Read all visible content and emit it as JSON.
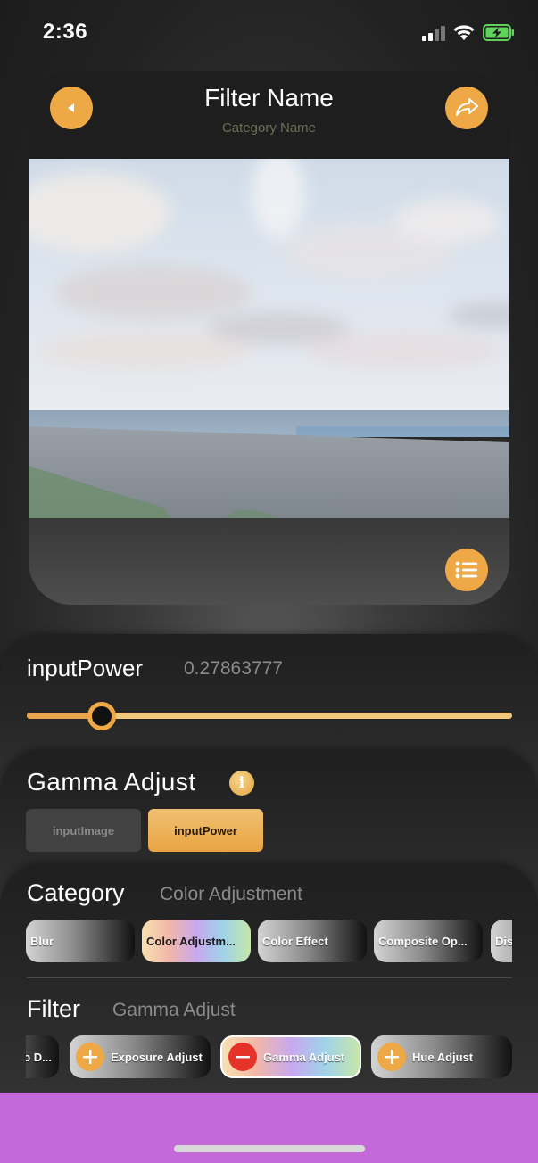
{
  "status_bar": {
    "time": "2:36"
  },
  "header": {
    "filter_name": "Filter Name",
    "category_name": "Category Name",
    "back_icon": "triangle-left-icon",
    "share_icon": "share-arrow-icon"
  },
  "preview": {
    "menu_icon": "list-icon"
  },
  "parameter": {
    "label": "inputPower",
    "value": "0.27863777",
    "slider_fraction": 0.154
  },
  "filter_detail": {
    "title": "Gamma Adjust",
    "info_icon": "info-icon",
    "inputs": [
      {
        "label": "inputImage",
        "selected": false
      },
      {
        "label": "inputPower",
        "selected": true
      }
    ]
  },
  "category_row": {
    "title": "Category",
    "selected": "Color Adjustment",
    "items": [
      "Blur",
      "Color Adjustm...",
      "Color Effect",
      "Composite Op...",
      "Dis"
    ]
  },
  "filter_row": {
    "title": "Filter",
    "selected": "Gamma Adjust",
    "items": [
      {
        "label": "o D...",
        "icon": ""
      },
      {
        "label": "Exposure Adjust",
        "icon": "plus-icon"
      },
      {
        "label": "Gamma Adjust",
        "icon": "minus-icon"
      },
      {
        "label": "Hue Adjust",
        "icon": "plus-icon"
      }
    ]
  },
  "colors": {
    "accent": "#eea846",
    "remove": "#e5332a",
    "bottom_bar": "#c46ad8"
  }
}
